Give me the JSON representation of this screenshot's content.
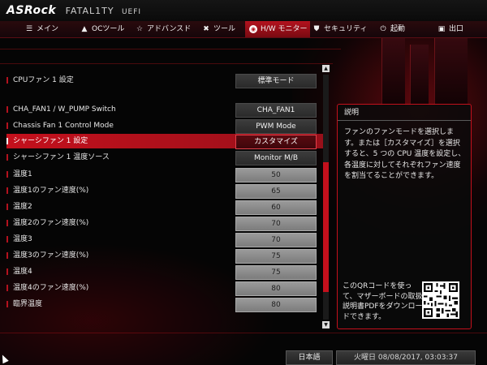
{
  "brand": {
    "name": "ASRock",
    "product": "FATAL1TY",
    "suffix": "UEFI"
  },
  "menu": {
    "tabs": [
      {
        "label": "メイン",
        "icon": "list-icon",
        "glyph": "☰"
      },
      {
        "label": "OCツール",
        "icon": "flame-icon",
        "glyph": "🔥"
      },
      {
        "label": "アドバンスド",
        "icon": "star-icon",
        "glyph": "☆"
      },
      {
        "label": "ツール",
        "icon": "wrench-icon",
        "glyph": "✖"
      },
      {
        "label": "H/W モニター",
        "icon": "hw-monitor-icon",
        "glyph": "◉"
      },
      {
        "label": "セキュリティ",
        "icon": "shield-icon",
        "glyph": "⛊"
      },
      {
        "label": "起動",
        "icon": "power-icon",
        "glyph": "⏻"
      },
      {
        "label": "出口",
        "icon": "exit-icon",
        "glyph": "▣"
      }
    ],
    "active_tab": "H/W モニター"
  },
  "settings": [
    {
      "label": "CPUファン 1 設定",
      "value": "標準モード"
    },
    {
      "label": "CHA_FAN1 / W_PUMP Switch",
      "value": "CHA_FAN1"
    },
    {
      "label": "Chassis Fan 1 Control Mode",
      "value": "PWM Mode"
    },
    {
      "label": "シャーシファン 1 設定",
      "value": "カスタマイズ",
      "selected": true
    },
    {
      "label": "シャーシファン 1 温度ソース",
      "value": "Monitor M/B"
    },
    {
      "label": "温度1",
      "value": "50"
    },
    {
      "label": "温度1のファン速度(%)",
      "value": "65"
    },
    {
      "label": "温度2",
      "value": "60"
    },
    {
      "label": "温度2のファン速度(%)",
      "value": "70"
    },
    {
      "label": "温度3",
      "value": "70"
    },
    {
      "label": "温度3のファン速度(%)",
      "value": "75"
    },
    {
      "label": "温度4",
      "value": "75"
    },
    {
      "label": "温度4のファン速度(%)",
      "value": "80"
    },
    {
      "label": "臨界温度",
      "value": "80"
    }
  ],
  "description": {
    "title": "説明",
    "text": "ファンのファンモードを選択します。または［カスタマイズ］を選択すると、5 つの CPU 温度を設定し、各温度に対してそれぞれファン速度を割当てることができます。",
    "qr_text": "このQRコードを使って、マザーボードの取扱説明書PDFをダウンロードできます。"
  },
  "footer": {
    "language": "日本語",
    "datetime": "火曜日 08/08/2017, 03:03:37"
  },
  "colors": {
    "accent": "#c4101c",
    "background": "#050505"
  }
}
